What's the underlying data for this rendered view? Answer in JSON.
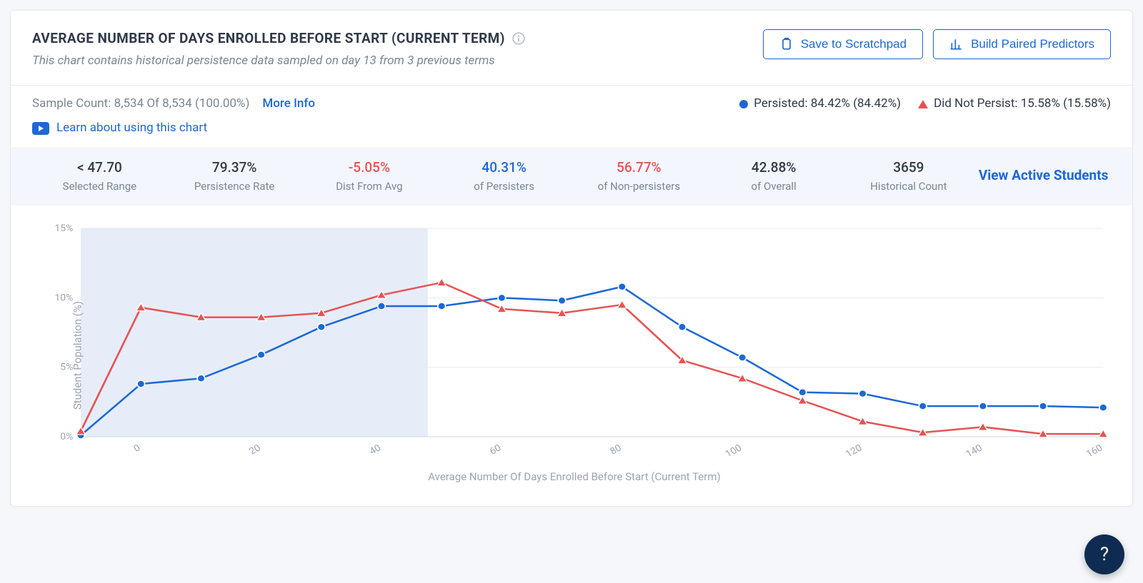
{
  "header": {
    "title": "AVERAGE NUMBER OF DAYS ENROLLED BEFORE START (CURRENT TERM)",
    "subtitle": "This chart contains historical persistence data sampled on day 13 from 3 previous terms",
    "save_label": "Save to Scratchpad",
    "build_label": "Build Paired Predictors"
  },
  "sample": {
    "text": "Sample Count: 8,534 Of 8,534 (100.00%)",
    "more_info": "More Info",
    "learn": "Learn about using this chart"
  },
  "legend": {
    "persisted": "Persisted: 84.42% (84.42%)",
    "did_not_persist": "Did Not Persist: 15.58% (15.58%)"
  },
  "stats": [
    {
      "value": "< 47.70",
      "label": "Selected Range",
      "cls": ""
    },
    {
      "value": "79.37%",
      "label": "Persistence Rate",
      "cls": ""
    },
    {
      "value": "-5.05%",
      "label": "Dist From Avg",
      "cls": "red"
    },
    {
      "value": "40.31%",
      "label": "of Persisters",
      "cls": "blue"
    },
    {
      "value": "56.77%",
      "label": "of Non-persisters",
      "cls": "red"
    },
    {
      "value": "42.88%",
      "label": "of Overall",
      "cls": ""
    },
    {
      "value": "3659",
      "label": "Historical Count",
      "cls": ""
    }
  ],
  "view_active": "View Active Students",
  "help": "?",
  "chart_data": {
    "type": "line",
    "title": "",
    "xlabel": "Average Number Of Days Enrolled Before Start (Current Term)",
    "ylabel": "Student Population (%)",
    "ylim": [
      0,
      15
    ],
    "yticks": [
      0,
      5,
      10,
      15
    ],
    "xticks": [
      0,
      20,
      40,
      60,
      80,
      100,
      120,
      140,
      160
    ],
    "selected_range_max": 47.7,
    "x": [
      -10,
      0,
      10,
      20,
      30,
      40,
      50,
      60,
      70,
      80,
      90,
      100,
      110,
      120,
      130,
      140,
      150,
      160
    ],
    "series": [
      {
        "name": "Persisted",
        "color": "#1d68d4",
        "marker": "circle",
        "values": [
          0.1,
          3.8,
          4.2,
          5.9,
          7.9,
          9.4,
          9.4,
          10.0,
          9.8,
          10.8,
          7.9,
          5.7,
          3.2,
          3.1,
          2.2,
          2.2,
          2.2,
          2.1
        ]
      },
      {
        "name": "Did Not Persist",
        "color": "#e55454",
        "marker": "triangle",
        "values": [
          0.4,
          9.3,
          8.6,
          8.6,
          8.9,
          10.2,
          11.1,
          9.2,
          8.9,
          9.5,
          5.5,
          4.2,
          2.6,
          1.1,
          0.3,
          0.7,
          0.2,
          0.2
        ]
      }
    ]
  }
}
